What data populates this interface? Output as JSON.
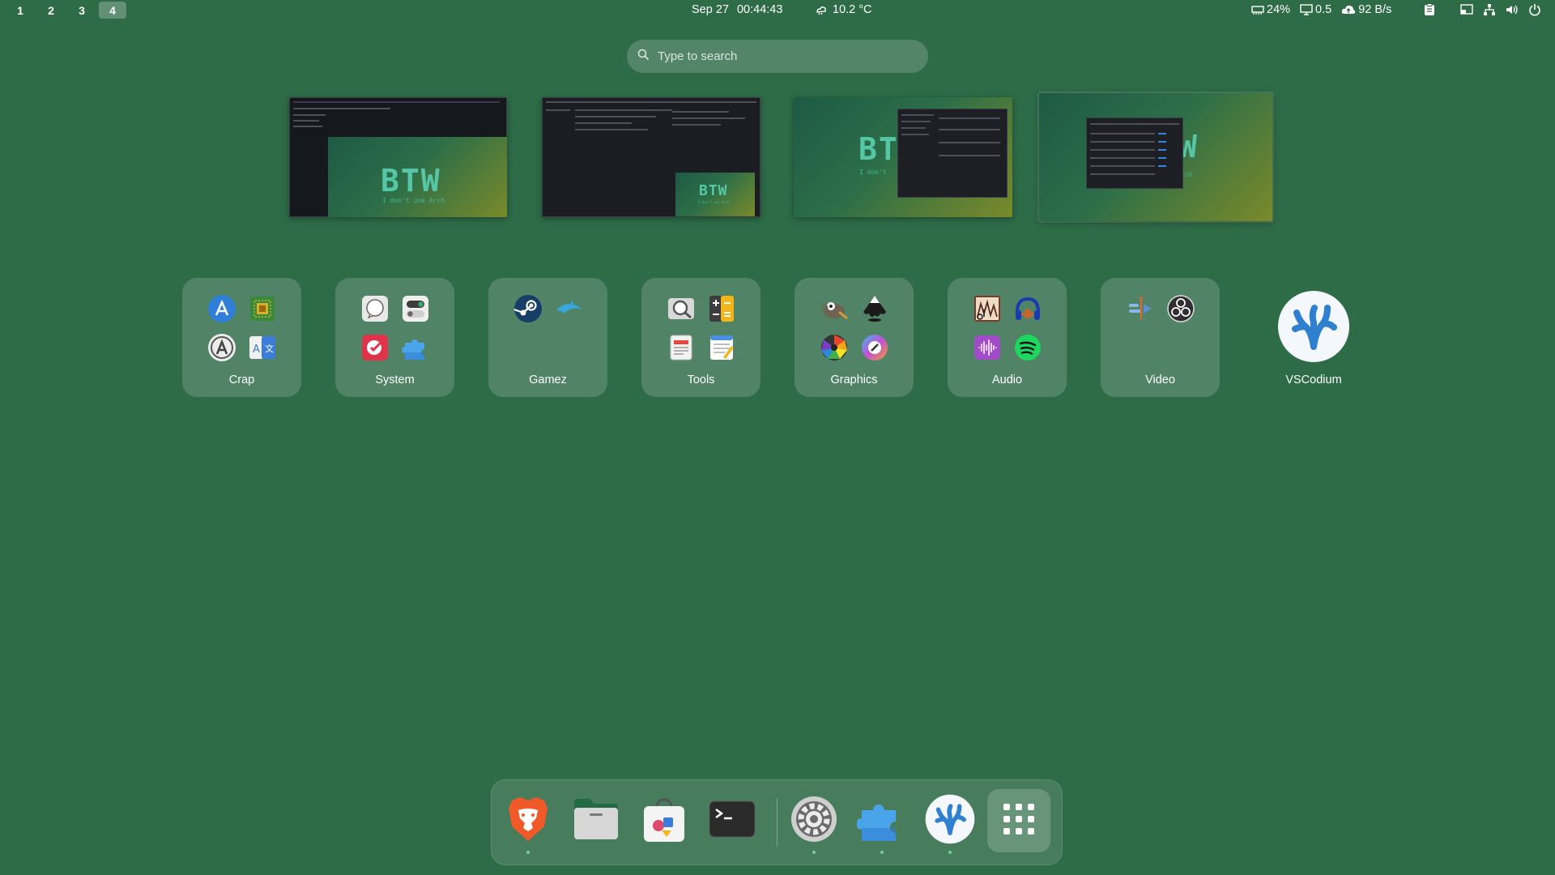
{
  "topbar": {
    "workspaces": [
      "1",
      "2",
      "3",
      "4"
    ],
    "active_workspace": "4",
    "date": "Sep 27",
    "time": "00:44:43",
    "weather": "10.2 °C",
    "memory": "24%",
    "cpu_load": "0.5",
    "net_speed": "92 B/s",
    "tray_icons": [
      "clipboard-icon",
      "screen-cast-icon",
      "network-icon",
      "volume-icon",
      "power-icon"
    ]
  },
  "search": {
    "placeholder": "Type to search"
  },
  "workspace_thumbnails": [
    {
      "banner": "BTW",
      "subtitle": "I don't use Arch"
    },
    {
      "banner": "BTW",
      "subtitle": "I don't use Arch"
    },
    {
      "banner": "BTW",
      "subtitle": "I don't"
    },
    {
      "banner": "W",
      "subtitle": "rch"
    }
  ],
  "folders": [
    {
      "label": "Crap",
      "icons": [
        "app-store-icon",
        "cpu-icon",
        "software-updater-icon",
        "translate-icon"
      ]
    },
    {
      "label": "System",
      "icons": [
        "speech-bubble-icon",
        "tweaks-toggle-icon",
        "tasks-check-icon",
        "extensions-icon"
      ]
    },
    {
      "label": "Gamez",
      "icons": [
        "steam-icon",
        "dolphin-icon"
      ]
    },
    {
      "label": "Tools",
      "icons": [
        "magnifier-icon",
        "calculator-icon",
        "document-viewer-icon",
        "text-editor-icon"
      ]
    },
    {
      "label": "Graphics",
      "icons": [
        "gimp-icon",
        "inkscape-icon",
        "darktable-icon",
        "color-picker-icon"
      ]
    },
    {
      "label": "Audio",
      "icons": [
        "music-studio-icon",
        "audacity-icon",
        "sound-recorder-icon",
        "spotify-icon"
      ]
    },
    {
      "label": "Video",
      "icons": [
        "video-trimmer-icon",
        "obs-icon"
      ]
    }
  ],
  "single_app": {
    "label": "VSCodium",
    "icon": "vscodium-icon"
  },
  "dock": [
    {
      "name": "brave-browser-icon",
      "running": true
    },
    {
      "name": "files-icon",
      "running": false
    },
    {
      "name": "software-store-icon",
      "running": false
    },
    {
      "name": "terminal-icon",
      "running": false
    },
    {
      "name": "settings-icon",
      "running": true
    },
    {
      "name": "extensions-icon",
      "running": true
    },
    {
      "name": "vscodium-icon",
      "running": true
    },
    {
      "name": "show-apps-icon",
      "running": false
    }
  ]
}
